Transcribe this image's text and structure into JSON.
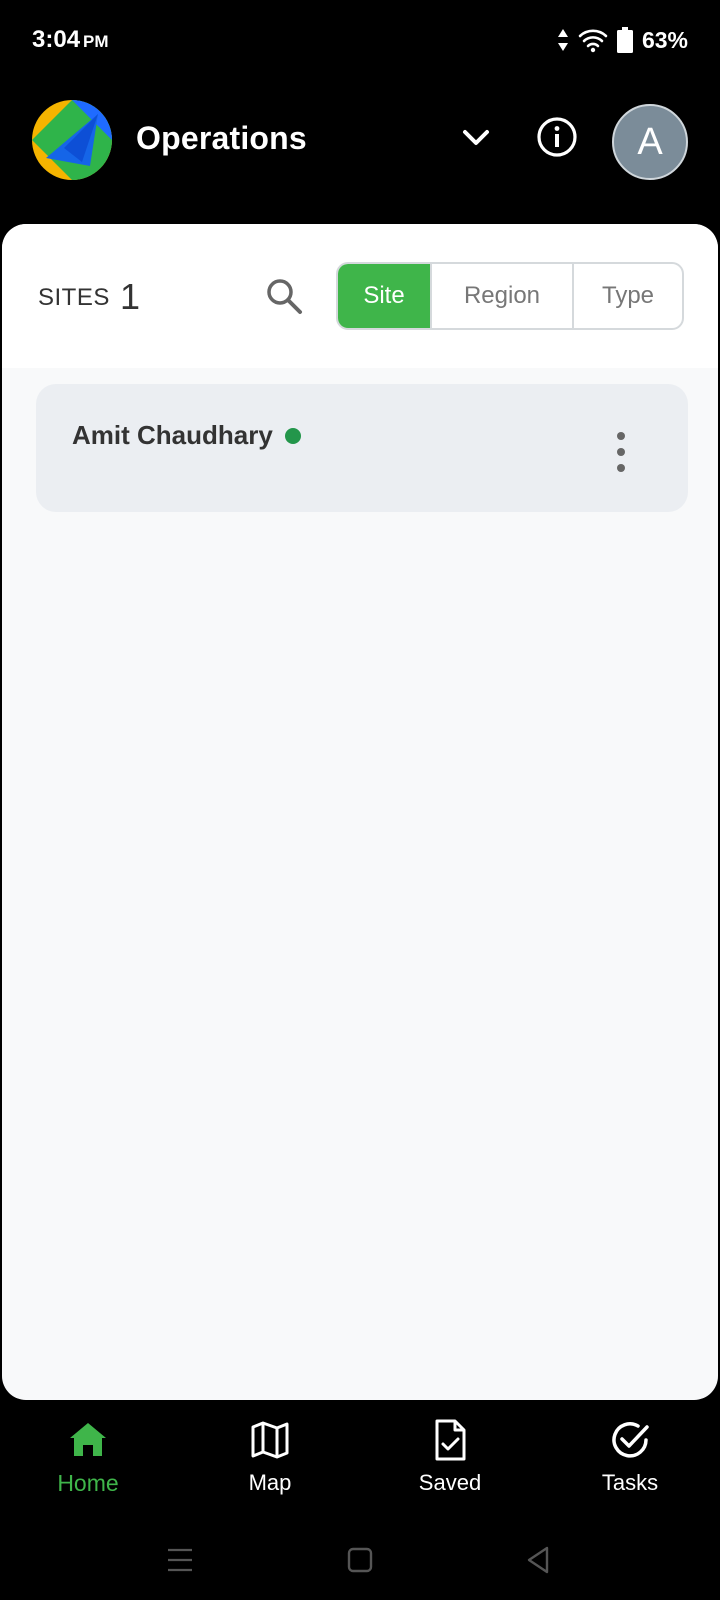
{
  "status_bar": {
    "time": "3:04",
    "ampm": "PM",
    "battery": "63%"
  },
  "header": {
    "title": "Operations"
  },
  "avatar": {
    "initial": "A"
  },
  "sites": {
    "label": "SITES",
    "count": "1"
  },
  "filter_tabs": {
    "site": "Site",
    "region": "Region",
    "type": "Type",
    "selected": "Site"
  },
  "site_list": [
    {
      "name": "Amit Chaudhary",
      "status_color": "#23964b"
    }
  ],
  "bottom_nav": {
    "home": "Home",
    "map": "Map",
    "saved": "Saved",
    "tasks": "Tasks",
    "active": "Home"
  },
  "colors": {
    "accent": "#3fb54a",
    "online": "#23964b",
    "avatar_bg": "#7b8c99"
  },
  "icons": [
    "signal-icon",
    "wifi-icon",
    "battery-icon",
    "chevron-down-icon",
    "info-icon",
    "search-icon",
    "more-vertical-icon",
    "home-icon",
    "map-icon",
    "saved-file-icon",
    "tasks-check-icon",
    "recents-icon",
    "home-square-icon",
    "back-icon"
  ]
}
